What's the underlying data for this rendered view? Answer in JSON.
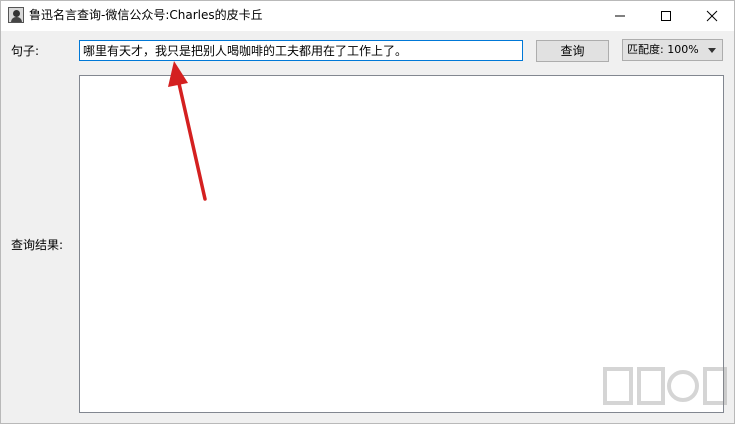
{
  "window": {
    "title": "鲁迅名言查询-微信公众号:Charles的皮卡丘"
  },
  "form": {
    "sentence_label": "句子:",
    "sentence_value": "哪里有天才，我只是把别人喝咖啡的工夫都用在了工作上了。",
    "query_button": "查询",
    "match_select_value": "匹配度: 100%",
    "result_label": "查询结果:"
  },
  "colors": {
    "input_focus_border": "#0078d7",
    "annotation_arrow": "#d42020"
  }
}
